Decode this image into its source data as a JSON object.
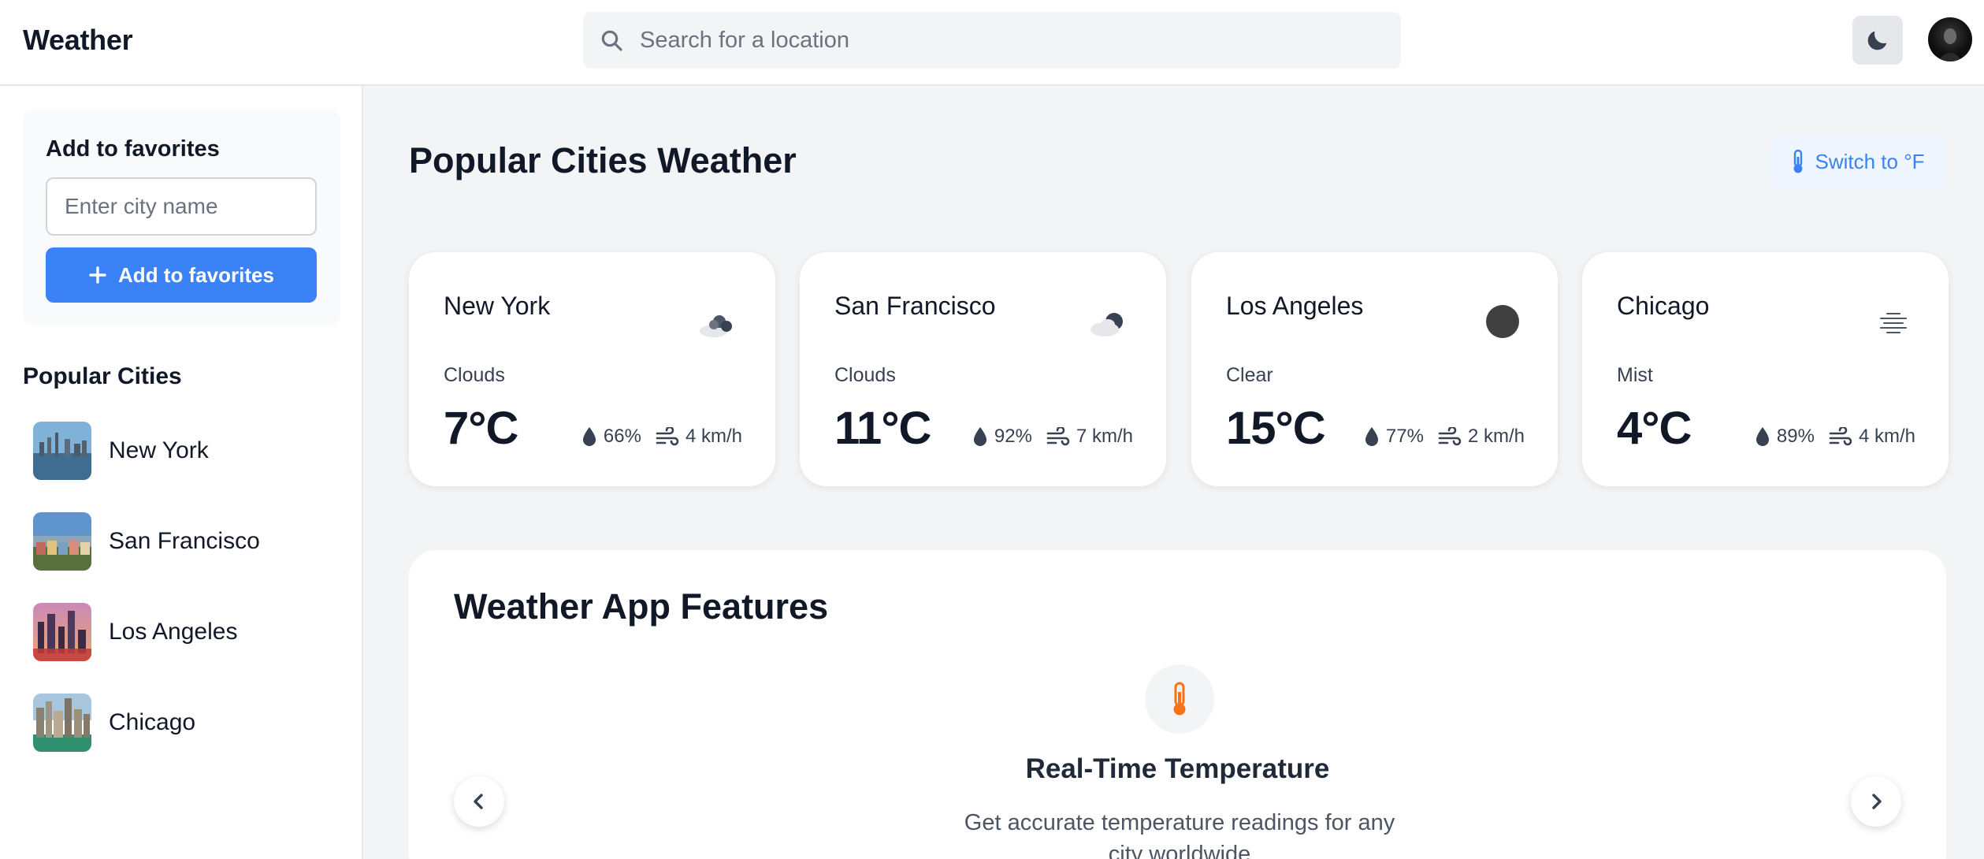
{
  "header": {
    "app_title": "Weather",
    "search_placeholder": "Search for a location",
    "search_value": ""
  },
  "sidebar": {
    "favorites": {
      "title": "Add to favorites",
      "input_placeholder": "Enter city name",
      "input_value": "",
      "button_label": "Add to favorites"
    },
    "popular_title": "Popular Cities",
    "cities": [
      {
        "name": "New York"
      },
      {
        "name": "San Francisco"
      },
      {
        "name": "Los Angeles"
      },
      {
        "name": "Chicago"
      }
    ]
  },
  "main": {
    "title": "Popular Cities Weather",
    "unit_button_label": "Switch to °F",
    "cards": [
      {
        "city": "New York",
        "condition": "Clouds",
        "temp": "7°C",
        "humidity": "66%",
        "wind": "4 km/h",
        "icon": "cloudy-icon"
      },
      {
        "city": "San Francisco",
        "condition": "Clouds",
        "temp": "11°C",
        "humidity": "92%",
        "wind": "7 km/h",
        "icon": "partly-cloudy-icon"
      },
      {
        "city": "Los Angeles",
        "condition": "Clear",
        "temp": "15°C",
        "humidity": "77%",
        "wind": "2 km/h",
        "icon": "clear-icon"
      },
      {
        "city": "Chicago",
        "condition": "Mist",
        "temp": "4°C",
        "humidity": "89%",
        "wind": "4 km/h",
        "icon": "mist-icon"
      }
    ],
    "features": {
      "title": "Weather App Features",
      "item_title": "Real-Time Temperature",
      "item_desc": "Get accurate temperature readings for any city worldwide"
    }
  },
  "colors": {
    "accent": "#3b82f6",
    "feature_icon": "#f97316",
    "text_dark": "#111827"
  }
}
